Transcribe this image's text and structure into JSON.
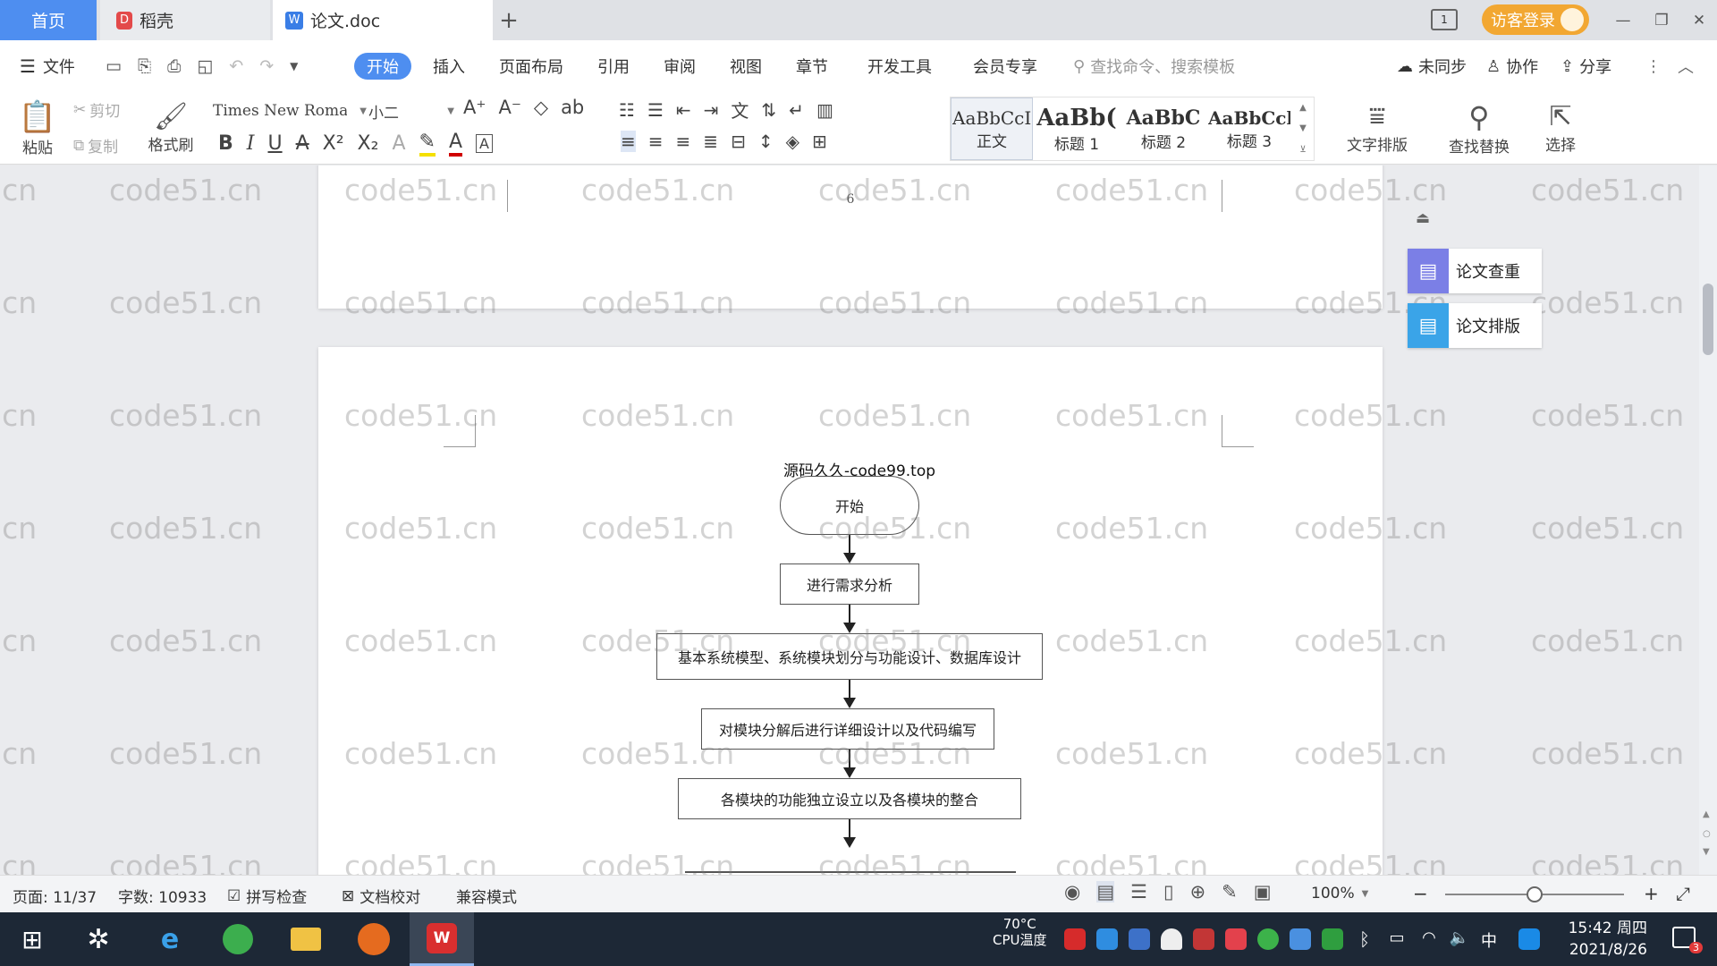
{
  "tabs": {
    "home": "首页",
    "daoke": "稻壳",
    "doc": "论文.doc",
    "add": "+"
  },
  "window": {
    "login": "访客登录",
    "minimize": "—",
    "restore": "❐",
    "close": "✕"
  },
  "menu": {
    "file": "文件",
    "items": [
      "开始",
      "插入",
      "页面布局",
      "引用",
      "审阅",
      "视图",
      "章节",
      "开发工具",
      "会员专享"
    ],
    "search_placeholder": "查找命令、搜索模板",
    "unsync": "未同步",
    "collab": "协作",
    "share": "分享"
  },
  "ribbon": {
    "paste": "粘贴",
    "cut": "剪切",
    "copy": "复制",
    "format_painter": "格式刷",
    "font_name": "Times New Roman",
    "font_size": "小二",
    "styles": [
      {
        "preview": "AaBbCcI",
        "name": "正文"
      },
      {
        "preview": "AaBb(",
        "name": "标题 1"
      },
      {
        "preview": "AaBbC",
        "name": "标题 2"
      },
      {
        "preview": "AaBbCcl",
        "name": "标题 3"
      }
    ],
    "text_layout": "文字排版",
    "find_replace": "查找替换",
    "select": "选择"
  },
  "document": {
    "page_number": "6",
    "header_text": "源码久久-code99.top",
    "watermark": "code51.cn",
    "flowchart": {
      "start": "开始",
      "steps": [
        "进行需求分析",
        "基本系统模型、系统模块划分与功能设计、数据库设计",
        "对模块分解后进行详细设计以及代码编写",
        "各模块的功能独立设立以及各模块的整合"
      ]
    }
  },
  "side_panel": {
    "check": "论文查重",
    "layout": "论文排版"
  },
  "status": {
    "page": "页面: 11/37",
    "words": "字数: 10933",
    "spell": "拼写检查",
    "proof": "文档校对",
    "compat": "兼容模式",
    "zoom": "100%",
    "zoom_level": 0.5
  },
  "taskbar": {
    "temp": "70°C",
    "cpu": "CPU温度",
    "ime": "中",
    "time": "15:42 周四",
    "date": "2021/8/26",
    "notif": "3"
  },
  "colors": {
    "accent": "#4e8ef0",
    "login": "#f2a732",
    "wps_red": "#d92f2f",
    "check": "#7b7fe6",
    "layout": "#3aa4e8"
  }
}
